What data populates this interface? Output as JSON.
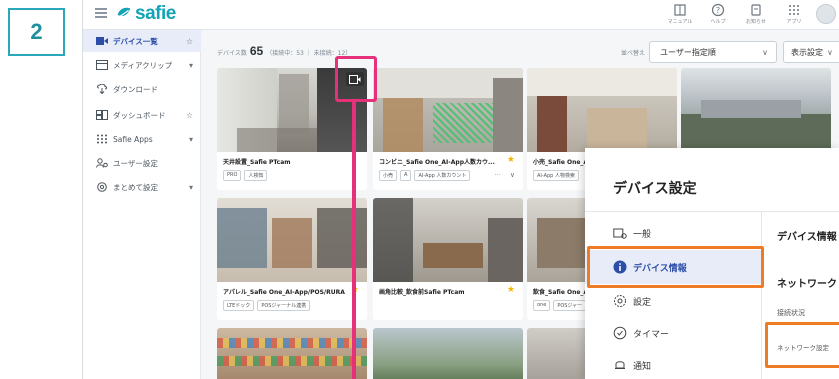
{
  "step_number": "2",
  "brand": {
    "name": "safie"
  },
  "top_icons": [
    {
      "label": "マニュアル",
      "icon": "manual-icon"
    },
    {
      "label": "ヘルプ",
      "icon": "help-icon"
    },
    {
      "label": "お知らせ",
      "icon": "notice-icon"
    },
    {
      "label": "アプリ",
      "icon": "apps-grid-icon"
    }
  ],
  "sidebar": {
    "items": [
      {
        "label": "デバイス一覧",
        "icon": "device-list-icon",
        "trail": "☆"
      },
      {
        "label": "メディアクリップ",
        "icon": "media-clip-icon",
        "trail": "▾"
      },
      {
        "label": "ダウンロード",
        "icon": "download-icon",
        "trail": ""
      },
      {
        "label": "ダッシュボード",
        "icon": "dashboard-icon",
        "trail": "☆"
      },
      {
        "label": "Safie Apps",
        "icon": "apps-icon",
        "trail": "▾"
      },
      {
        "label": "ユーザー設定",
        "icon": "user-settings-icon",
        "trail": ""
      },
      {
        "label": "まとめて設定",
        "icon": "bulk-settings-icon",
        "trail": "▾"
      }
    ]
  },
  "device_summary": {
    "label": "デバイス数",
    "count": "65",
    "detail": "（接続中：53 ｜ 未接続：12）"
  },
  "sort": {
    "label": "並べ替え",
    "value": "ユーザー指定順"
  },
  "display_settings": {
    "label": "表示設定"
  },
  "devices": [
    {
      "name": "天井設置_Safie PTcam",
      "tags": [
        "PRO",
        "人検知"
      ],
      "starred": false
    },
    {
      "name": "コンビニ_Safie One_AI-App人数カウ...",
      "tags": [
        "小売",
        "A",
        "AI-App 人数カウント"
      ],
      "starred": true
    },
    {
      "name": "小売_Safie One_A",
      "tags": [
        "AI-App 人物検索"
      ],
      "starred": false
    },
    {
      "name": "",
      "tags": [],
      "starred": false
    },
    {
      "name": "アパレル_Safie One_AI-App/POS/RURA",
      "tags": [
        "LTEドック",
        "POSジャーナル連携"
      ],
      "starred": false
    },
    {
      "name": "画角比較_飲食前Safie PTcam",
      "tags": [],
      "starred": true
    },
    {
      "name": "飲食_Safie One_A",
      "tags": [
        "one",
        "POSジャー"
      ],
      "starred": false
    }
  ],
  "settings_panel": {
    "title": "デバイス設定",
    "nav": [
      {
        "label": "一般",
        "icon": "general-icon"
      },
      {
        "label": "デバイス情報",
        "icon": "info-icon",
        "active": true
      },
      {
        "label": "設定",
        "icon": "settings-gear-icon"
      },
      {
        "label": "タイマー",
        "icon": "timer-icon"
      },
      {
        "label": "通知",
        "icon": "bell-icon"
      }
    ],
    "right_title": "デバイス情報",
    "right_section": "ネットワーク",
    "right_status_label": "接続状況",
    "right_network_label": "ネットワーク設定"
  },
  "colors": {
    "brand_teal": "#12a4b6",
    "highlight_pink": "#e7307a",
    "highlight_orange": "#ef7b25",
    "active_bg": "#e7ecf8",
    "active_text": "#2c4ea8"
  }
}
